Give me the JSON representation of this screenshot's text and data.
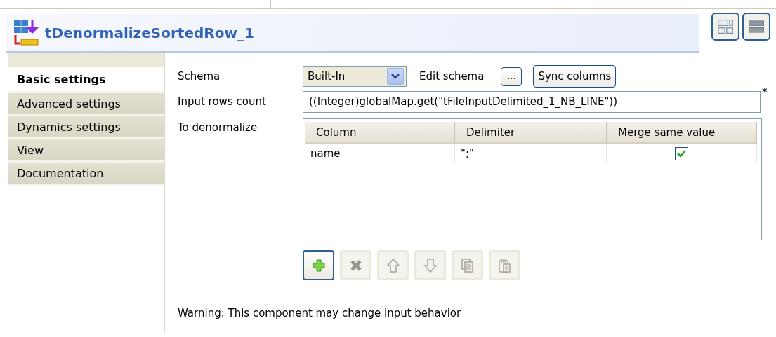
{
  "header": {
    "title": "tDenormalizeSortedRow_1"
  },
  "sidebar": {
    "items": [
      {
        "label": "Basic settings",
        "selected": true
      },
      {
        "label": "Advanced settings",
        "selected": false
      },
      {
        "label": "Dynamics settings",
        "selected": false
      },
      {
        "label": "View",
        "selected": false
      },
      {
        "label": "Documentation",
        "selected": false
      }
    ]
  },
  "schema": {
    "label": "Schema",
    "value": "Built-In",
    "edit_label": "Edit schema",
    "edit_button": "…",
    "sync_button": "Sync columns"
  },
  "input_rows": {
    "label": "Input rows count",
    "value": "((Integer)globalMap.get(\"tFileInputDelimited_1_NB_LINE\"))",
    "required_mark": "*"
  },
  "denormalize": {
    "label": "To denormalize",
    "columns": [
      "Column",
      "Delimiter",
      "Merge same value"
    ],
    "rows": [
      {
        "column": "name",
        "delimiter": "\";\"",
        "merge": true
      }
    ]
  },
  "toolbar": [
    {
      "kind": "add",
      "disabled": false
    },
    {
      "kind": "remove",
      "disabled": true
    },
    {
      "kind": "up",
      "disabled": true
    },
    {
      "kind": "down",
      "disabled": true
    },
    {
      "kind": "copy",
      "disabled": true
    },
    {
      "kind": "paste",
      "disabled": true
    }
  ],
  "warning": "Warning: This component may change input behavior"
}
